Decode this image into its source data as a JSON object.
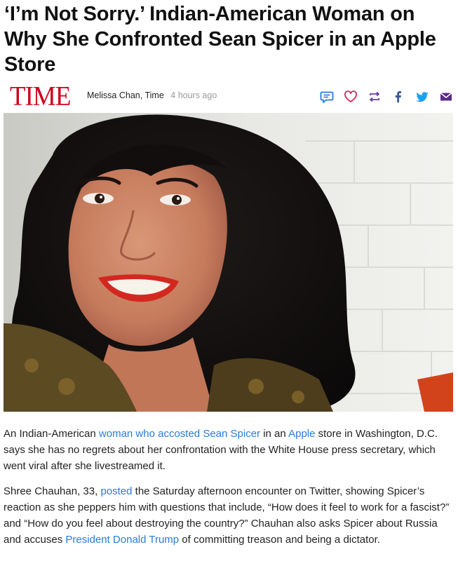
{
  "article": {
    "headline": "‘I’m Not Sorry.’ Indian-American Woman on Why She Confronted Sean Spicer in an Apple Store",
    "brand": "TIME",
    "author": "Melissa Chan,",
    "publication": "Time",
    "time_ago": "4 hours ago"
  },
  "share_icons": [
    {
      "name": "comment-icon",
      "color": "#2a7ad8"
    },
    {
      "name": "heart-icon",
      "color": "#e0245e"
    },
    {
      "name": "repost-icon",
      "color": "#6b3fa0"
    },
    {
      "name": "facebook-icon",
      "color": "#3b5998"
    },
    {
      "name": "twitter-icon",
      "color": "#1da1f2"
    },
    {
      "name": "email-icon",
      "color": "#5b2a86"
    }
  ],
  "paragraphs": {
    "p1": {
      "t1": "An Indian-American ",
      "link1": "woman who accosted Sean Spicer",
      "t2": " in an ",
      "link2": "Apple",
      "t3": " store in Washington, D.C. says she has no regrets about her confrontation with the White House press secretary, which went viral after she livestreamed it."
    },
    "p2": {
      "t1": "Shree Chauhan, 33, ",
      "link1": "posted",
      "t2": " the Saturday afternoon encounter on Twitter, showing Spicer’s reaction as she peppers him with questions that include, “How does it feel to work for a fascist?” and “How do you feel about destroying the country?” Chauhan also asks Spicer about Russia and accuses ",
      "link2": "President Donald Trump",
      "t3": " of committing treason and being a dictator."
    }
  }
}
